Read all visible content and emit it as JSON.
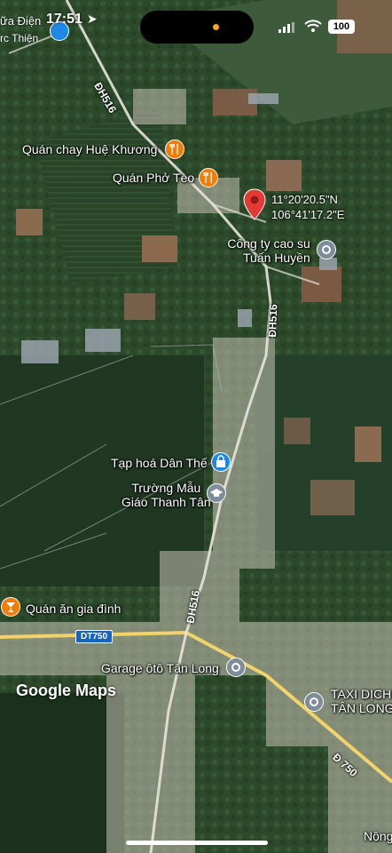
{
  "status_bar": {
    "time": "17:51",
    "battery": "100",
    "previous_app_line1": "ữa Điện",
    "previous_app_line2": "rc Thiện"
  },
  "map": {
    "selected_pin": {
      "lat": "11°20'20.5\"N",
      "lng": "106°41'17.2\"E",
      "color": "#e53935"
    },
    "roads": [
      {
        "label": "ĐH516"
      },
      {
        "label": "ĐH516"
      },
      {
        "label": "ĐH516"
      },
      {
        "label": "Đ 750"
      }
    ],
    "route_shield": "DT750",
    "places": [
      {
        "name": "Quán chay Huệ Khương",
        "type": "restaurant",
        "icon": "fork-knife-icon"
      },
      {
        "name": "Quán Phở Tèo",
        "type": "restaurant",
        "icon": "fork-knife-icon"
      },
      {
        "name": "Công ty cao su",
        "name2": "Tuấn Huyền",
        "type": "business",
        "icon": "pin-icon"
      },
      {
        "name": "Tạp hoá Dân Thế",
        "type": "shop",
        "icon": "shopping-bag-icon"
      },
      {
        "name": "Trường Mẫu",
        "name2": "Giáo Thanh Tân",
        "type": "school",
        "icon": "graduation-cap-icon"
      },
      {
        "name": "Quán ăn gia đình",
        "type": "bar",
        "icon": "cocktail-icon"
      },
      {
        "name": "Garage ôtô Tân Long",
        "type": "business",
        "icon": "pin-icon"
      },
      {
        "name": "TAXI DỊCH",
        "name2": "TÂN LONG",
        "type": "business",
        "icon": "pin-icon"
      },
      {
        "name": "Nông",
        "type": "business",
        "icon": "none"
      }
    ],
    "attribution": "Google Maps",
    "colors": {
      "restaurant": "#f57c00",
      "shop": "#1e88e5",
      "business": "#7f8c99",
      "school": "#7f8c99"
    }
  }
}
